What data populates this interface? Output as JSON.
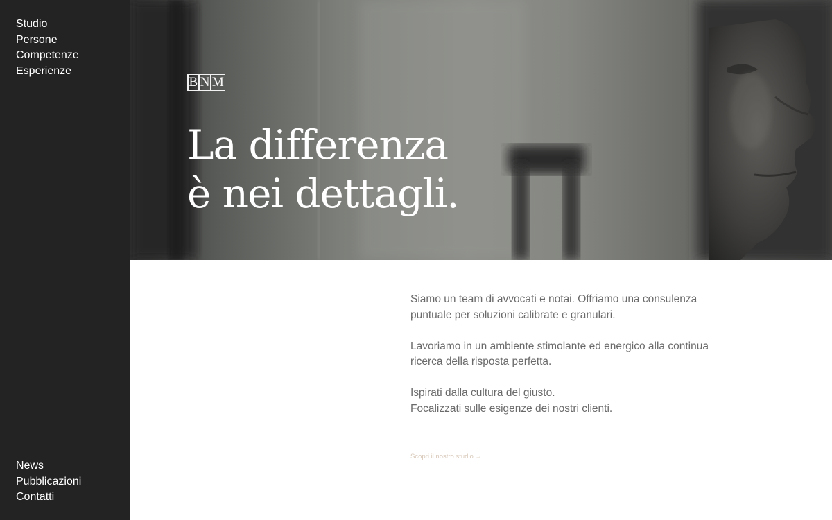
{
  "nav": {
    "top": [
      "Studio",
      "Persone",
      "Competenze",
      "Esperienze"
    ],
    "bottom": [
      "News",
      "Pubblicazioni",
      "Contatti"
    ]
  },
  "logo": {
    "letters": [
      "B",
      "N",
      "M"
    ]
  },
  "hero": {
    "headline_line1": "La differenza",
    "headline_line2": "è nei dettagli."
  },
  "intro": {
    "paragraphs": [
      [
        "Siamo un team di avvocati e notai. Offriamo una consulenza",
        "puntuale per soluzioni calibrate e granulari."
      ],
      [
        "Lavoriamo in un ambiente stimolante ed energico alla continua",
        "ricerca della risposta perfetta."
      ],
      [
        "Ispirati dalla cultura del giusto.",
        "Focalizzati sulle esigenze dei nostri clienti."
      ]
    ],
    "cta_label": "Scopri il nostro studio →"
  },
  "colors": {
    "sidebar_bg": "#232323",
    "body_text": "#6a6a6a",
    "cta_text": "#d8c8b8"
  }
}
